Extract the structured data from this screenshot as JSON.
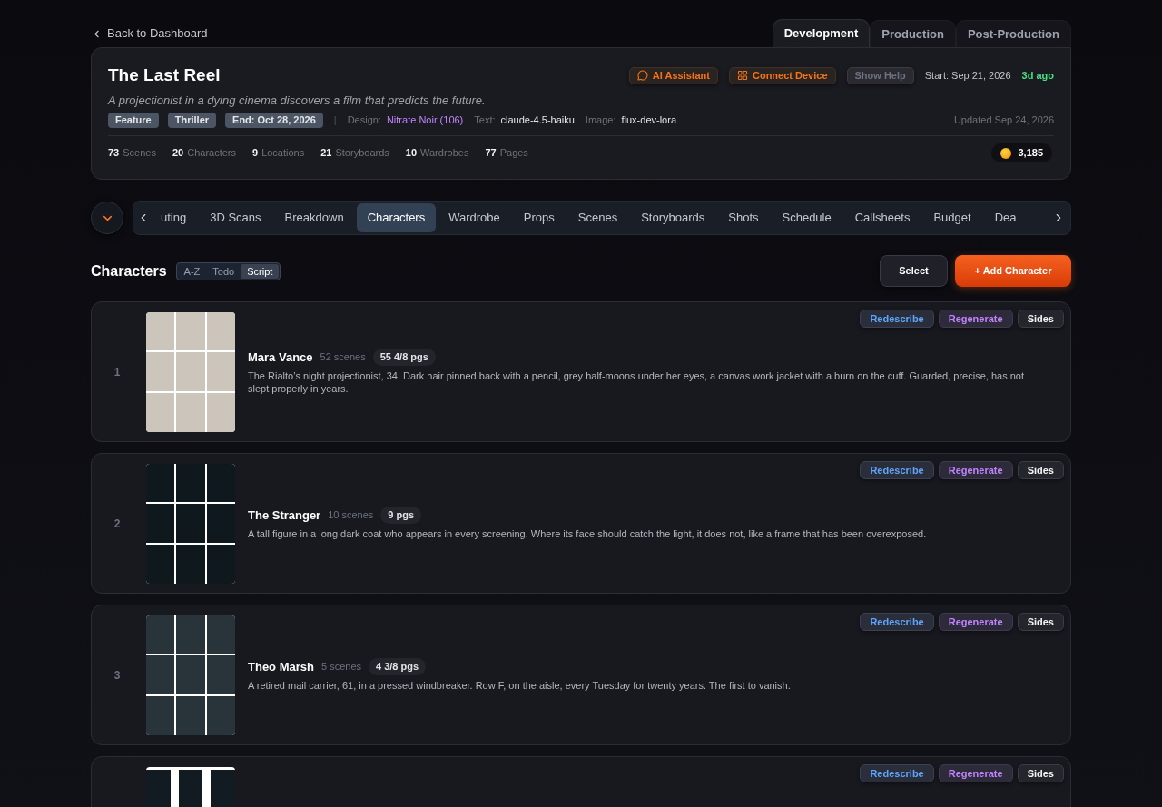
{
  "back_link": {
    "label": "Back to Dashboard"
  },
  "phase_tabs": [
    {
      "label": "Development",
      "selected": true
    },
    {
      "label": "Production",
      "selected": false
    },
    {
      "label": "Post-Production",
      "selected": false
    }
  ],
  "project": {
    "title": "The Last Reel",
    "actions": [
      {
        "kind": "chat",
        "label": "AI Assistant"
      },
      {
        "kind": "device",
        "label": "Connect Device"
      },
      {
        "kind": "help",
        "label": "Show Help"
      }
    ],
    "start": "Start: Sep 21, 2026",
    "age": "3d ago",
    "logline": "A projectionist in a dying cinema discovers a film that predicts the future.",
    "tags": [
      "Feature",
      "Thriller",
      "End: Oct 28, 2026"
    ],
    "separator": "|",
    "models": [
      {
        "label": "Design:",
        "value": "Nitrate Noir (106)",
        "kind": "link"
      },
      {
        "label": "Text:",
        "value": "claude-4.5-haiku",
        "kind": "plain"
      },
      {
        "label": "Image:",
        "value": "flux-dev-lora",
        "kind": "plain"
      }
    ],
    "updated": "Updated Sep 24, 2026",
    "stats": [
      {
        "count": "73",
        "label": "Scenes"
      },
      {
        "count": "20",
        "label": "Characters"
      },
      {
        "count": "9",
        "label": "Locations"
      },
      {
        "count": "21",
        "label": "Storyboards"
      },
      {
        "count": "10",
        "label": "Wardrobes"
      },
      {
        "count": "77",
        "label": "Pages"
      }
    ],
    "credits": "3,185"
  },
  "section_tabs": [
    {
      "label": "uting",
      "selected": false
    },
    {
      "label": "3D Scans",
      "selected": false
    },
    {
      "label": "Breakdown",
      "selected": false
    },
    {
      "label": "Characters",
      "selected": true
    },
    {
      "label": "Wardrobe",
      "selected": false
    },
    {
      "label": "Props",
      "selected": false
    },
    {
      "label": "Scenes",
      "selected": false
    },
    {
      "label": "Storyboards",
      "selected": false
    },
    {
      "label": "Shots",
      "selected": false
    },
    {
      "label": "Schedule",
      "selected": false
    },
    {
      "label": "Callsheets",
      "selected": false
    },
    {
      "label": "Budget",
      "selected": false
    },
    {
      "label": "Dea",
      "selected": false
    }
  ],
  "characters_section": {
    "title": "Characters",
    "sort_options": [
      {
        "label": "A-Z",
        "selected": false
      },
      {
        "label": "Todo",
        "selected": false
      },
      {
        "label": "Script",
        "selected": true
      }
    ],
    "select_button": "Select",
    "add_button": "+ Add Character"
  },
  "characters": [
    {
      "kind": "light",
      "number": "1",
      "name": "Mara Vance",
      "scenes": "52 scenes",
      "pages": "55 4/8 pgs",
      "description": "The Rialto’s night projectionist, 34. Dark hair pinned back with a pencil, grey half-moons under her eyes, a canvas work jacket with a burn on the cuff. Guarded, precise, has not slept properly in years.",
      "actions": [
        {
          "kind": "describe",
          "label": "Redescribe"
        },
        {
          "kind": "generate",
          "label": "Regenerate"
        },
        {
          "kind": "plain",
          "label": "Sides"
        }
      ]
    },
    {
      "kind": "dark",
      "number": "2",
      "name": "The Stranger",
      "scenes": "10 scenes",
      "pages": "9 pgs",
      "description": "A tall figure in a long dark coat who appears in every screening. Where its face should catch the light, it does not, like a frame that has been overexposed.",
      "actions": [
        {
          "kind": "describe",
          "label": "Redescribe"
        },
        {
          "kind": "generate",
          "label": "Regenerate"
        },
        {
          "kind": "plain",
          "label": "Sides"
        }
      ]
    },
    {
      "kind": "slate",
      "number": "3",
      "name": "Theo Marsh",
      "scenes": "5 scenes",
      "pages": "4 3/8 pgs",
      "description": "A retired mail carrier, 61, in a pressed windbreaker. Row F, on the aisle, every Tuesday for twenty years. The first to vanish.",
      "actions": [
        {
          "kind": "describe",
          "label": "Redescribe"
        },
        {
          "kind": "generate",
          "label": "Regenerate"
        },
        {
          "kind": "plain",
          "label": "Sides"
        }
      ]
    },
    {
      "kind": "framed",
      "actions": [
        {
          "kind": "describe",
          "label": "Redescribe"
        },
        {
          "kind": "generate",
          "label": "Regenerate"
        },
        {
          "kind": "plain",
          "label": "Sides"
        }
      ]
    }
  ]
}
